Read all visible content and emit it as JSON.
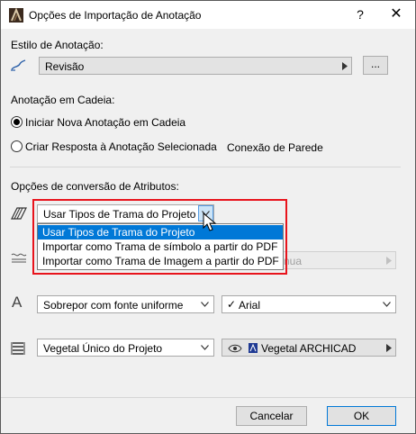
{
  "window": {
    "title": "Opções de Importação de Anotação",
    "help_glyph": "?",
    "close_glyph": "✕"
  },
  "annotation_style": {
    "label": "Estilo de Anotação:",
    "value": "Revisão",
    "browse_label": "..."
  },
  "chain": {
    "label": "Anotação em Cadeia:",
    "options": [
      {
        "label": "Iniciar Nova Anotação em Cadeia",
        "selected": true
      },
      {
        "label": "Criar Resposta à Anotação Selecionada",
        "selected": false
      }
    ],
    "extra_label": "Conexão de Parede"
  },
  "attributes": {
    "label": "Opções de conversão de Atributos:",
    "fill": {
      "value": "Usar Tipos de Trama do Projeto",
      "dropdown_open": true,
      "options": [
        {
          "label": "Usar Tipos de Trama do Projeto",
          "highlighted": true
        },
        {
          "label": "Importar como Trama de símbolo a partir do PDF",
          "highlighted": false
        },
        {
          "label": "Importar como Trama de Imagem a partir do PDF",
          "highlighted": false
        }
      ]
    },
    "line": {
      "partial_text": "nua",
      "disabled": true
    },
    "font": {
      "mode_value": "Sobrepor com fonte uniforme",
      "font_value": "Arial",
      "check_glyph": "✓"
    },
    "material": {
      "value": "Vegetal Único do Projeto",
      "material_value": "Vegetal ARCHICAD"
    }
  },
  "footer": {
    "cancel_label": "Cancelar",
    "ok_label": "OK"
  },
  "colors": {
    "highlight": "#0078d7",
    "callout_border": "#e8141c"
  }
}
